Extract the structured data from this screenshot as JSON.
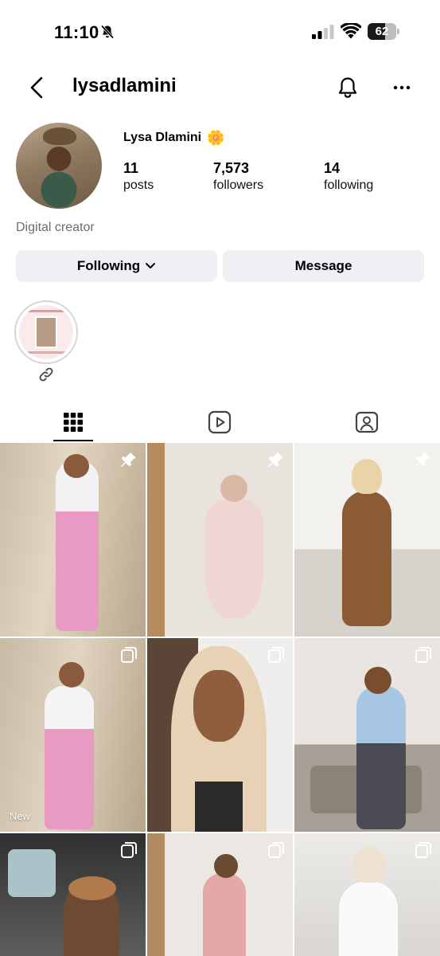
{
  "status_bar": {
    "time": "11:10",
    "battery_level": "62"
  },
  "header": {
    "username": "lysadlamini"
  },
  "profile": {
    "display_name": "Lysa Dlamini",
    "display_name_emoji": "🌼",
    "stats": [
      {
        "value": "11",
        "label": "posts"
      },
      {
        "value": "7,573",
        "label": "followers"
      },
      {
        "value": "14",
        "label": "following"
      }
    ],
    "bio": "Digital creator",
    "buttons": {
      "following_label": "Following",
      "message_label": "Message"
    }
  },
  "tabs": [
    {
      "icon": "grid-icon",
      "active": true
    },
    {
      "icon": "reels-icon",
      "active": false
    },
    {
      "icon": "tagged-icon",
      "active": false
    }
  ],
  "grid": {
    "new_label": "New",
    "posts": [
      {
        "badge": "pin-icon"
      },
      {
        "badge": "pin-icon"
      },
      {
        "badge": "pin-icon"
      },
      {
        "badge": "carousel-icon",
        "new": true
      },
      {
        "badge": "carousel-icon"
      },
      {
        "badge": "carousel-icon"
      },
      {
        "badge": "carousel-icon"
      },
      {
        "badge": "carousel-icon"
      },
      {
        "badge": "carousel-icon"
      }
    ]
  },
  "colors": {
    "button_bg": "#eef0f3",
    "secondary_text": "#6b6b6b"
  }
}
